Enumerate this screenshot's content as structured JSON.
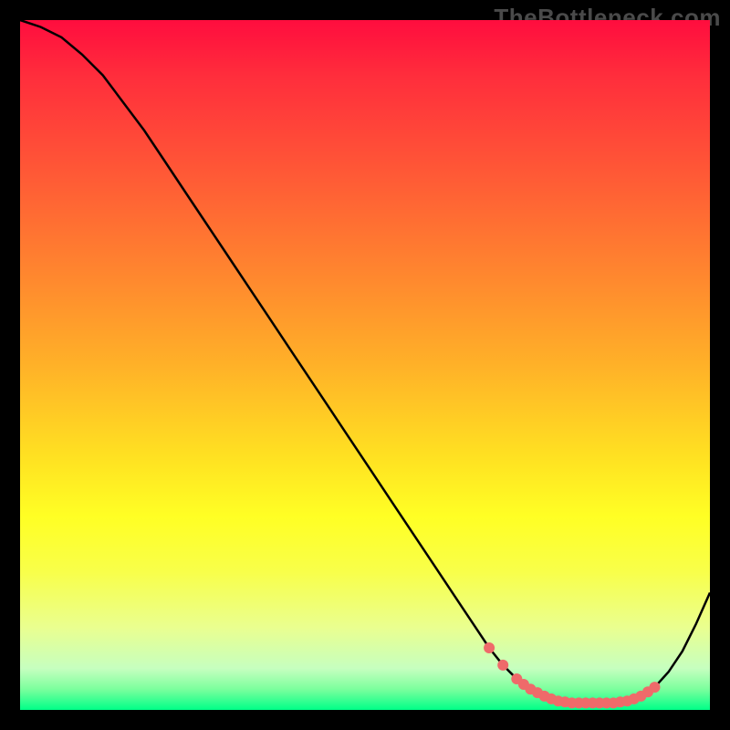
{
  "watermark": "TheBottleneck.com",
  "colors": {
    "curve": "#000000",
    "dots": "#ef6a6a",
    "gradient_top": "#ff0d3e",
    "gradient_bottom": "#00ff88"
  },
  "chart_data": {
    "type": "line",
    "title": "",
    "xlabel": "",
    "ylabel": "",
    "xlim": [
      0,
      100
    ],
    "ylim": [
      0,
      100
    ],
    "x": [
      0,
      3,
      6,
      9,
      12,
      15,
      18,
      21,
      24,
      27,
      30,
      33,
      36,
      39,
      42,
      45,
      48,
      51,
      54,
      57,
      60,
      63,
      66,
      68,
      70,
      72,
      74,
      76,
      78,
      80,
      82,
      84,
      86,
      88,
      90,
      92,
      94,
      96,
      98,
      100
    ],
    "y": [
      100,
      99,
      97.5,
      95,
      92,
      88,
      84,
      79.5,
      75,
      70.5,
      66,
      61.5,
      57,
      52.5,
      48,
      43.5,
      39,
      34.5,
      30,
      25.5,
      21,
      16.5,
      12,
      9,
      6.5,
      4.5,
      3,
      2,
      1.3,
      1,
      1,
      1,
      1,
      1.3,
      2,
      3.3,
      5.5,
      8.5,
      12.5,
      17
    ],
    "dots_x": [
      68,
      70,
      72,
      73,
      74,
      75,
      76,
      77,
      78,
      79,
      80,
      81,
      82,
      83,
      84,
      85,
      86,
      87,
      88,
      89,
      90,
      91,
      92
    ],
    "dots_y": [
      9,
      6.5,
      4.5,
      3.7,
      3,
      2.5,
      2,
      1.6,
      1.3,
      1.15,
      1,
      1,
      1,
      1,
      1,
      1,
      1,
      1.15,
      1.3,
      1.6,
      2,
      2.6,
      3.3
    ]
  }
}
